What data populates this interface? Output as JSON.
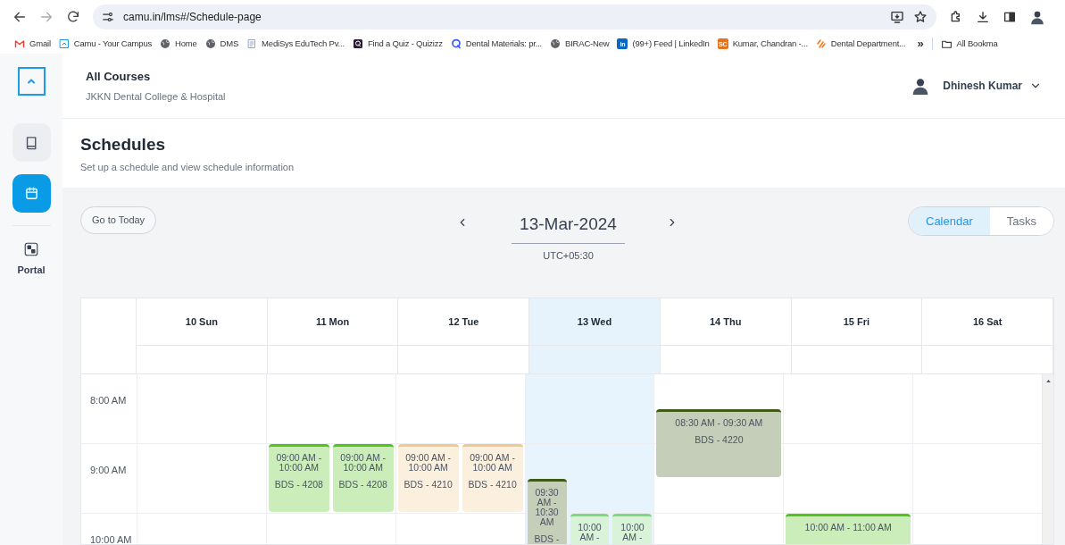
{
  "browser": {
    "url": "camu.in/lms#/Schedule-page",
    "bookmarks": [
      {
        "label": "Gmail",
        "kind": "gmail"
      },
      {
        "label": "Camu - Your Campus",
        "kind": "camu"
      },
      {
        "label": "Home",
        "kind": "globe"
      },
      {
        "label": "DMS",
        "kind": "globe"
      },
      {
        "label": "MediSys EduTech Pv...",
        "kind": "doc"
      },
      {
        "label": "Find a Quiz - Quizizz",
        "kind": "quizizz"
      },
      {
        "label": "Dental Materials: pr...",
        "kind": "ring"
      },
      {
        "label": "BIRAC-New",
        "kind": "globe"
      },
      {
        "label": "(99+) Feed | LinkedIn",
        "kind": "badge",
        "badge": "in",
        "color": "#0a66c2"
      },
      {
        "label": "Kumar, Chandran -...",
        "kind": "badge",
        "badge": "SC",
        "color": "#e8711c"
      },
      {
        "label": "Dental Department...",
        "kind": "stripes"
      }
    ],
    "more": "»",
    "all_bookmarks": "All Bookma"
  },
  "sidebar": {
    "items": [
      {
        "kind": "book",
        "selected": false
      },
      {
        "kind": "calendar",
        "selected": true
      },
      {
        "kind": "portal",
        "label": "Portal",
        "selected": false
      }
    ]
  },
  "header": {
    "title": "All Courses",
    "subtitle": "JKKN Dental College & Hospital",
    "user": "Dhinesh Kumar"
  },
  "page": {
    "title": "Schedules",
    "subtitle": "Set up a schedule and view schedule information"
  },
  "toolbar": {
    "today_button": "Go to Today",
    "date": "13-Mar-2024",
    "timezone": "UTC+05:30",
    "views": [
      {
        "label": "Calendar",
        "selected": true
      },
      {
        "label": "Tasks",
        "selected": false
      }
    ]
  },
  "calendar": {
    "hours": [
      "8:00 AM",
      "9:00 AM",
      "10:00 AM"
    ],
    "days": [
      {
        "label": "10 Sun",
        "selected": false
      },
      {
        "label": "11 Mon",
        "selected": false,
        "events": [
          {
            "time": "09:00 AM - 10:00 AM",
            "code": "BDS - 4208",
            "color": "#52c41a"
          },
          {
            "time": "09:00 AM - 10:00 AM",
            "code": "BDS - 4208",
            "color": "#52c41a"
          }
        ]
      },
      {
        "label": "12 Tue",
        "selected": false,
        "events": [
          {
            "time": "09:00 AM - 10:00 AM",
            "code": "BDS - 4210",
            "color": "#f0c890"
          },
          {
            "time": "09:00 AM - 10:00 AM",
            "code": "BDS - 4210",
            "color": "#f0c890"
          }
        ]
      },
      {
        "label": "13 Wed",
        "selected": true,
        "events": [
          {
            "time": "09:30 AM - 10:30 AM",
            "code": "BDS -",
            "color": "#3e5a16"
          },
          {
            "time": "10:00 AM -",
            "color": "#7ed87e"
          },
          {
            "time": "10:00 AM -",
            "color": "#7ed87e"
          }
        ]
      },
      {
        "label": "14 Thu",
        "selected": false,
        "events": [
          {
            "time": "08:30 AM - 09:30 AM",
            "code": "BDS - 4220",
            "color": "#3e5a16"
          }
        ]
      },
      {
        "label": "15 Fri",
        "selected": false,
        "events": [
          {
            "time": "10:00 AM - 11:00 AM",
            "color": "#52c41a"
          }
        ]
      },
      {
        "label": "16 Sat",
        "selected": false
      }
    ]
  }
}
